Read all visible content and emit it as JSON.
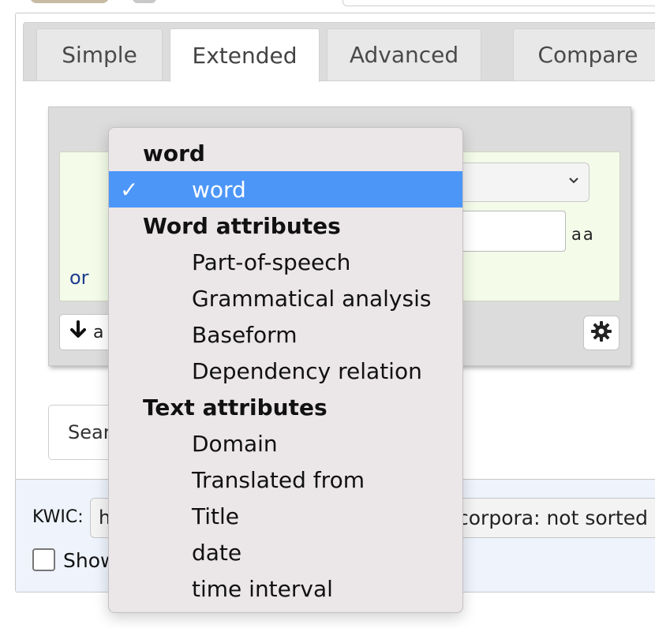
{
  "tabs": [
    {
      "label": "Simple"
    },
    {
      "label": "Extended"
    },
    {
      "label": "Advanced"
    },
    {
      "label": "Compare"
    }
  ],
  "panel": {
    "case_toggle": "aa",
    "or_label": "or",
    "add_button_label": "a",
    "search_button_partial": "Sear"
  },
  "bottom": {
    "kwic_label": "KWIC:",
    "kwic_value_partial": "h",
    "sort_text_partial": "corpora: not sorted",
    "show_label_partial": "Show"
  },
  "dropdown": {
    "groups": [
      {
        "header": "word",
        "options": [
          "word"
        ]
      },
      {
        "header": "Word attributes",
        "options": [
          "Part-of-speech",
          "Grammatical analysis",
          "Baseform",
          "Dependency relation"
        ]
      },
      {
        "header": "Text attributes",
        "options": [
          "Domain",
          "Translated from",
          "Title",
          "date",
          "time interval"
        ]
      }
    ],
    "selected": "word",
    "check_glyph": "✓"
  },
  "colors": {
    "selected_bg": "#4c96f8",
    "token_bg": "#f4fbe9",
    "or_color": "#1e3d8f"
  }
}
